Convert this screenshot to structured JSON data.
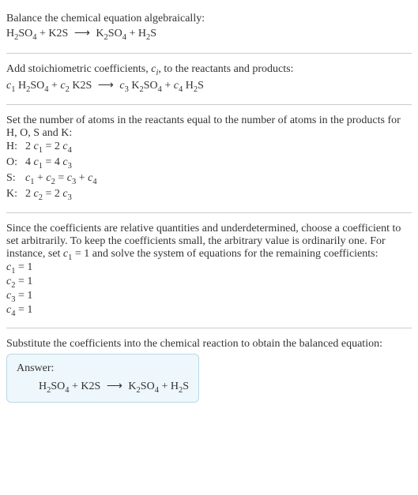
{
  "intro": {
    "line1": "Balance the chemical equation algebraically:",
    "reactant1": "H",
    "reactant1_sub1": "2",
    "reactant1_mid": "SO",
    "reactant1_sub2": "4",
    "plus1": " + K2S ",
    "arrow": "⟶",
    "product1": " K",
    "product1_sub1": "2",
    "product1_mid": "SO",
    "product1_sub2": "4",
    "plus2": " + H",
    "product2_sub1": "2",
    "product2_end": "S"
  },
  "stoich": {
    "line1": "Add stoichiometric coefficients, ",
    "ci": "c",
    "ci_sub": "i",
    "line1_end": ", to the reactants and products:",
    "c1": "c",
    "c1_sub": "1",
    "sp1": " H",
    "h_sub": "2",
    "so": "SO",
    "so_sub": "4",
    "plus1": " + ",
    "c2": "c",
    "c2_sub": "2",
    "k2s": " K2S ",
    "arrow": "⟶",
    "sp2": " ",
    "c3": "c",
    "c3_sub": "3",
    "k": " K",
    "k_sub": "2",
    "so2": "SO",
    "so2_sub": "4",
    "plus2": " + ",
    "c4": "c",
    "c4_sub": "4",
    "h2": " H",
    "h2_sub": "2",
    "s_end": "S"
  },
  "setnum": {
    "line1": "Set the number of atoms in the reactants equal to the number of atoms in the products for H, O, S and K:",
    "rows": {
      "h_label": "H:",
      "h_eq_a": "2 ",
      "h_c1": "c",
      "h_c1_sub": "1",
      "h_eq_mid": " = 2 ",
      "h_c4": "c",
      "h_c4_sub": "4",
      "o_label": "O:",
      "o_eq_a": "4 ",
      "o_c1": "c",
      "o_c1_sub": "1",
      "o_eq_mid": " = 4 ",
      "o_c3": "c",
      "o_c3_sub": "3",
      "s_label": "S:",
      "s_c1": "c",
      "s_c1_sub": "1",
      "s_plus": " + ",
      "s_c2": "c",
      "s_c2_sub": "2",
      "s_eq": " = ",
      "s_c3": "c",
      "s_c3_sub": "3",
      "s_plus2": " + ",
      "s_c4": "c",
      "s_c4_sub": "4",
      "k_label": "K:",
      "k_eq_a": "2 ",
      "k_c2": "c",
      "k_c2_sub": "2",
      "k_eq_mid": " = 2 ",
      "k_c3": "c",
      "k_c3_sub": "3"
    }
  },
  "choose": {
    "text_a": "Since the coefficients are relative quantities and underdetermined, choose a coefficient to set arbitrarily. To keep the coefficients small, the arbitrary value is ordinarily one. For instance, set ",
    "c1": "c",
    "c1_sub": "1",
    "text_b": " = 1 and solve the system of equations for the remaining coefficients:",
    "r1_c": "c",
    "r1_sub": "1",
    "r1_val": " = 1",
    "r2_c": "c",
    "r2_sub": "2",
    "r2_val": " = 1",
    "r3_c": "c",
    "r3_sub": "3",
    "r3_val": " = 1",
    "r4_c": "c",
    "r4_sub": "4",
    "r4_val": " = 1"
  },
  "substitute": {
    "text": "Substitute the coefficients into the chemical reaction to obtain the balanced equation:"
  },
  "answer": {
    "label": "Answer:",
    "h": "H",
    "h_sub": "2",
    "so": "SO",
    "so_sub": "4",
    "plus1": " + K2S ",
    "arrow": "⟶",
    "k": " K",
    "k_sub": "2",
    "so2": "SO",
    "so2_sub": "4",
    "plus2": " + H",
    "h2_sub": "2",
    "s": "S"
  }
}
